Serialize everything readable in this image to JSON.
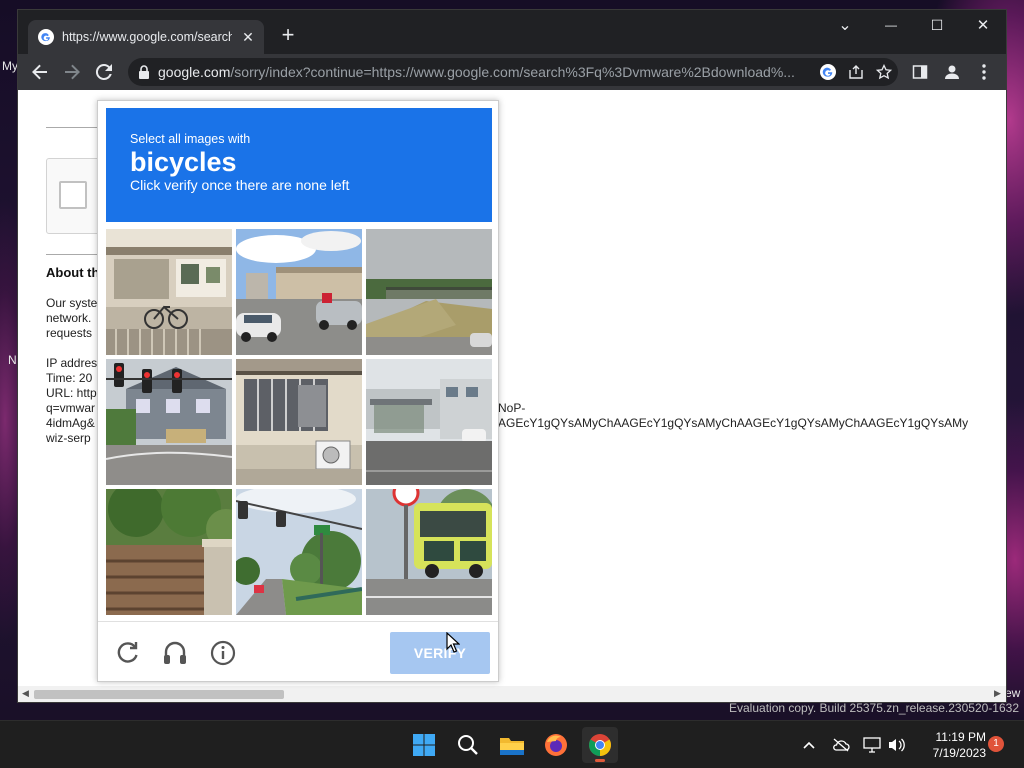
{
  "desktop": {
    "left_label_1": "My",
    "left_label_2": "N",
    "right_label": "ew"
  },
  "browser": {
    "tab": {
      "title": "https://www.google.com/search?q=vmware+download",
      "close_icon": "close-icon"
    },
    "new_tab_label": "+",
    "window_controls": {
      "chevron": "⌄",
      "minimize": "—",
      "maximize": "☐",
      "close": "✕"
    },
    "url": {
      "host": "google.com",
      "rest": "/sorry/index?continue=https://www.google.com/search%3Fq%3Dvmware%2Bdownload%..."
    }
  },
  "page": {
    "about_heading": "About th",
    "body_line_1": "Our syste",
    "body_line_2": "network.",
    "body_line_3": "requests",
    "ip_line": "IP addres",
    "time_line": "Time: 20",
    "url_line": "URL: http",
    "q_line": "q=vmwar",
    "token_line": "4idmAg&",
    "wiz_line": "wiz-serp",
    "overflow_line_1": "NoP-",
    "overflow_line_2": "AGEcY1gQYsAMyChAAGEcY1gQYsAMyChAAGEcY1gQYsAMyChAAGEcY1gQYsAMy"
  },
  "captcha": {
    "prompt": "Select all images with",
    "target": "bicycles",
    "instruction": "Click verify once there are none left",
    "verify_label": "VERIFY",
    "tiles": [
      {
        "name": "tile-storefront-bicycles"
      },
      {
        "name": "tile-street-cars"
      },
      {
        "name": "tile-bridge-overpass"
      },
      {
        "name": "tile-traffic-lights"
      },
      {
        "name": "tile-building-window"
      },
      {
        "name": "tile-bus-shelter"
      },
      {
        "name": "tile-fence-wall"
      },
      {
        "name": "tile-road-trees"
      },
      {
        "name": "tile-bus"
      }
    ]
  },
  "watermark": "Evaluation copy. Build 25375.zn_release.230520-1632",
  "taskbar": {
    "time": "11:19 PM",
    "date": "7/19/2023",
    "notification_count": "1"
  }
}
